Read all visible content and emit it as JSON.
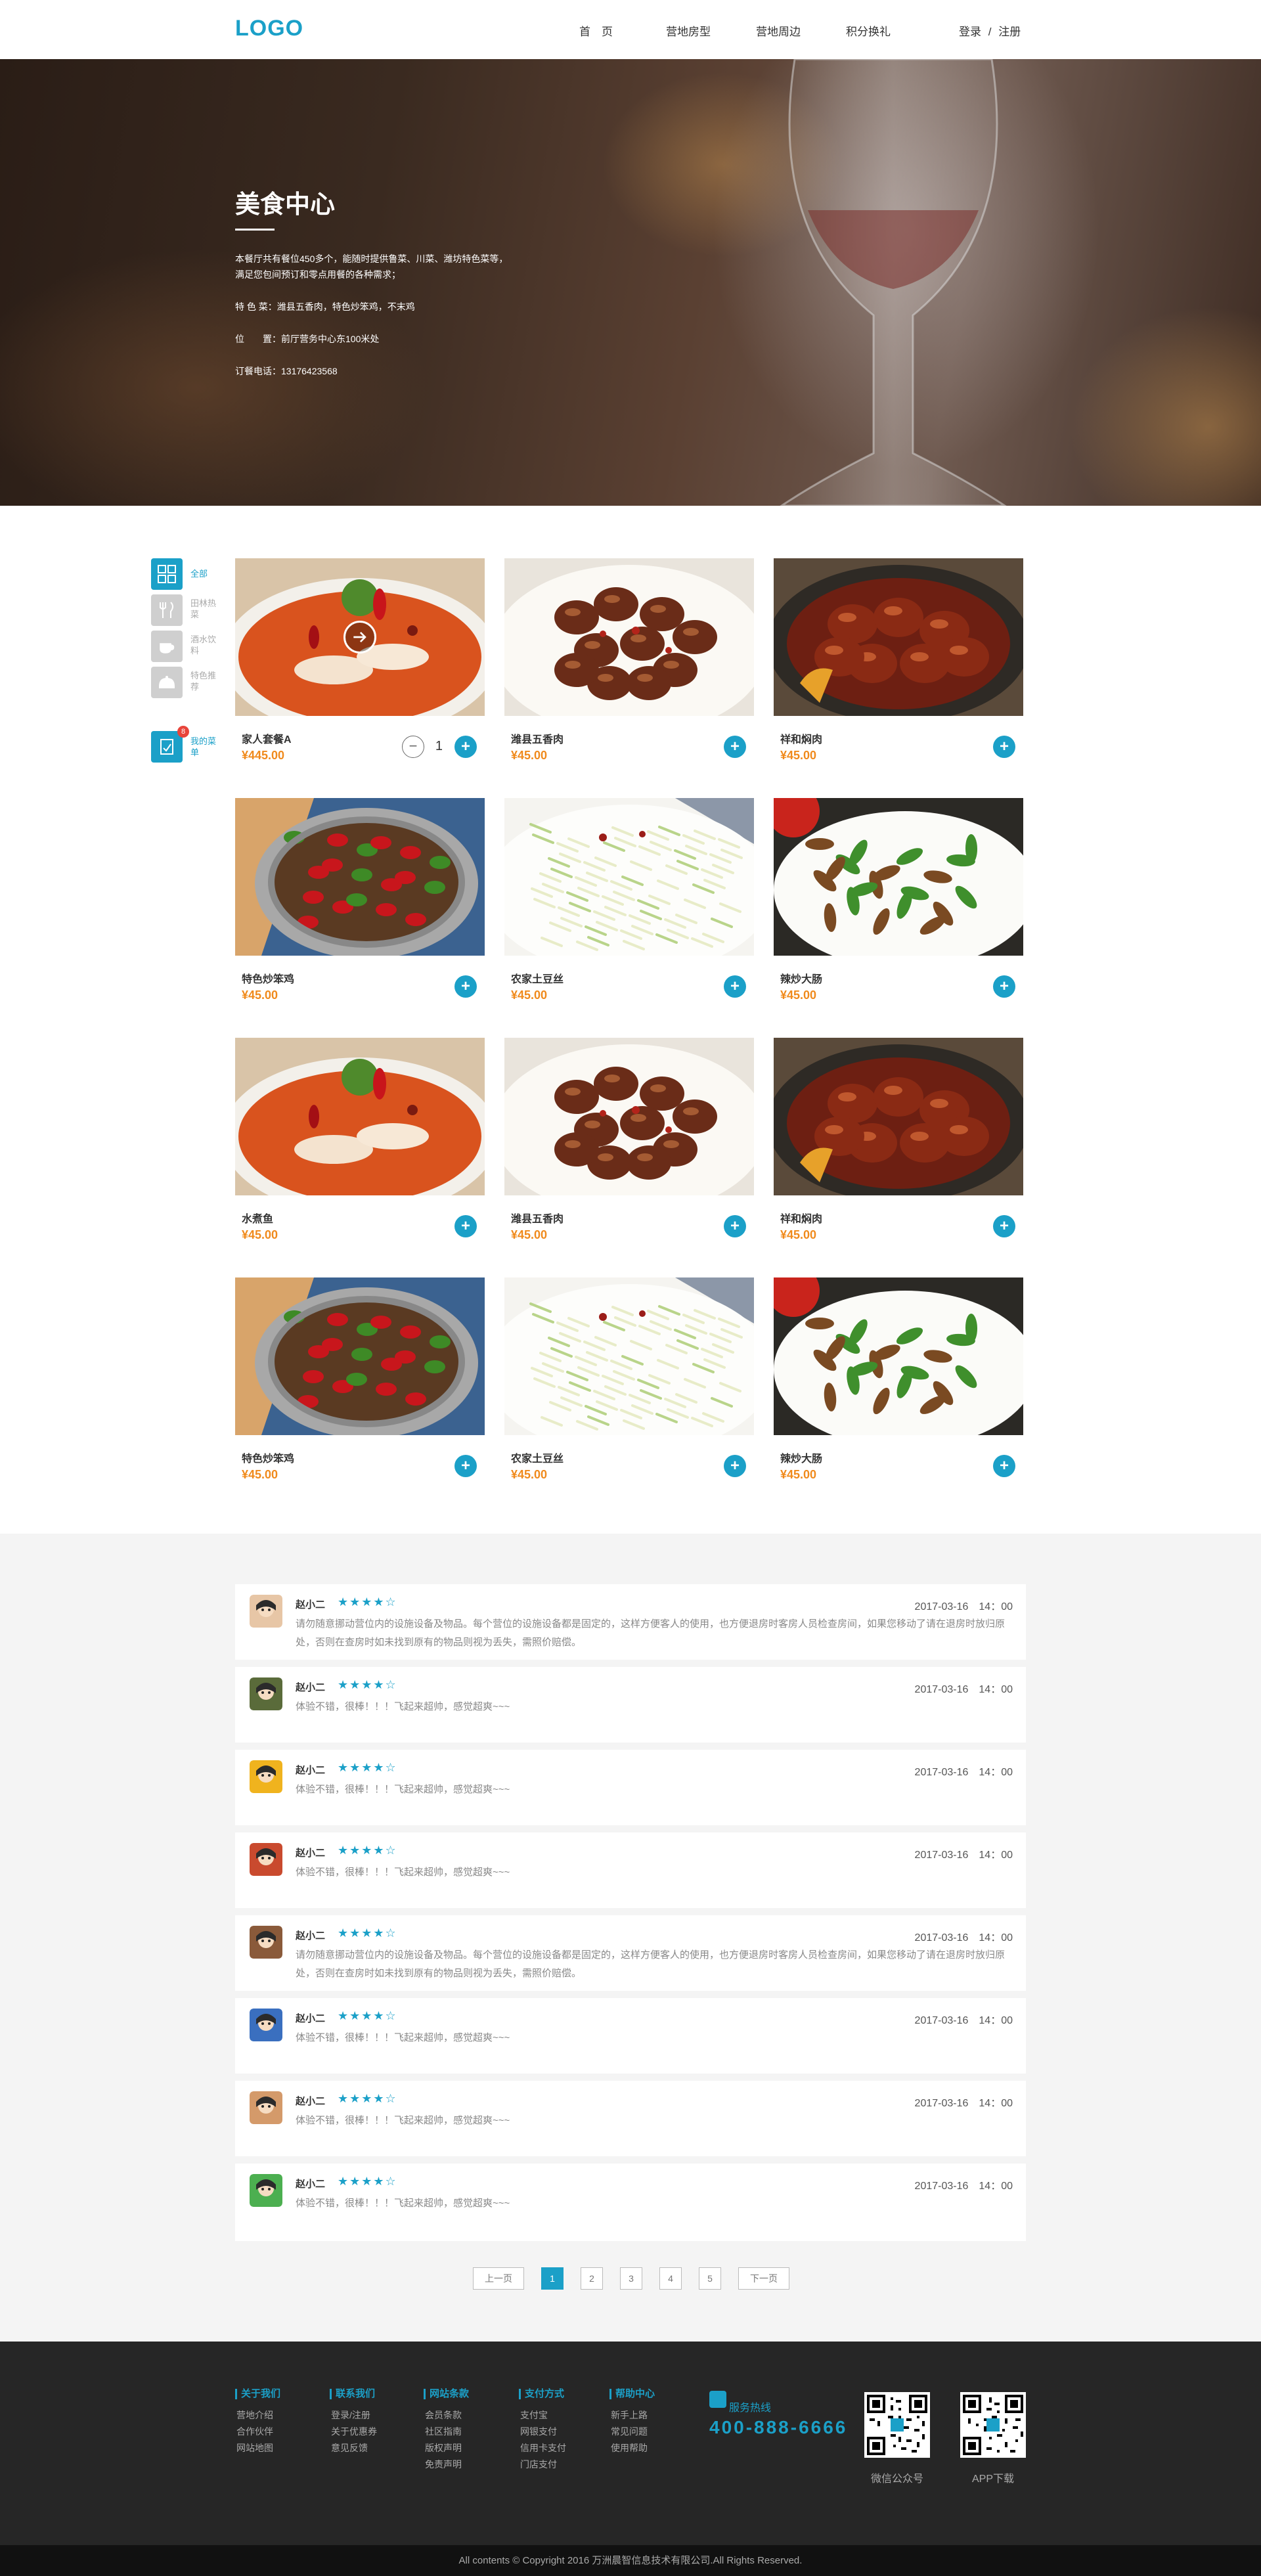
{
  "header": {
    "logo": "LOGO",
    "nav": [
      "首　页",
      "营地房型",
      "营地周边",
      "积分换礼"
    ],
    "login": "登录",
    "separator": "/",
    "register": "注册"
  },
  "hero": {
    "title": "美食中心",
    "intro_line1": "本餐厅共有餐位450多个，能随时提供鲁菜、川菜、潍坊特色菜等，",
    "intro_line2": "满足您包间预订和零点用餐的各种需求；",
    "specialty": "特 色 菜：潍县五香肉，特色炒笨鸡，不末鸡",
    "location": "位　　置：前厅营务中心东100米处",
    "phone": "订餐电话：13176423568"
  },
  "sidebar": {
    "items": [
      {
        "label": "全部",
        "icon": "grid-icon"
      },
      {
        "label": "田林热菜",
        "icon": "fork-knife-icon"
      },
      {
        "label": "酒水饮料",
        "icon": "coffee-cup-icon"
      },
      {
        "label": "特色推荐",
        "icon": "cloche-icon"
      }
    ],
    "menu_label": "我的菜单",
    "menu_badge": "8"
  },
  "dishes": [
    {
      "name": "家人套餐A",
      "price": "¥445.00",
      "quantity": "1",
      "image": "fish-hotpot"
    },
    {
      "name": "潍县五香肉",
      "price": "¥45.00",
      "image": "braised-pork"
    },
    {
      "name": "祥和焖肉",
      "price": "¥45.00",
      "image": "pot-stew"
    },
    {
      "name": "特色炒笨鸡",
      "price": "¥45.00",
      "image": "chicken-pot"
    },
    {
      "name": "农家土豆丝",
      "price": "¥45.00",
      "image": "potato-shreds"
    },
    {
      "name": "辣炒大肠",
      "price": "¥45.00",
      "image": "pepper-intestine"
    },
    {
      "name": "水煮鱼",
      "price": "¥45.00",
      "image": "fish-hotpot"
    },
    {
      "name": "潍县五香肉",
      "price": "¥45.00",
      "image": "braised-pork"
    },
    {
      "name": "祥和焖肉",
      "price": "¥45.00",
      "image": "pot-stew"
    },
    {
      "name": "特色炒笨鸡",
      "price": "¥45.00",
      "image": "chicken-pot"
    },
    {
      "name": "农家土豆丝",
      "price": "¥45.00",
      "image": "potato-shreds"
    },
    {
      "name": "辣炒大肠",
      "price": "¥45.00",
      "image": "pepper-intestine"
    }
  ],
  "comments": [
    {
      "name": "赵小二",
      "stars": "★★★★☆",
      "rating": 4,
      "date": "2017-03-16　14：00",
      "text": "请勿随意挪动营位内的设施设备及物品。每个营位的设施设备都是固定的，这样方便客人的使用，也方便退房时客房人员检查房间，如果您移动了请在退房时放归原处，否则在查房时如未找到原有的物品则视为丢失，需照价赔偿。"
    },
    {
      "name": "赵小二",
      "stars": "★★★★☆",
      "rating": 4,
      "date": "2017-03-16　14：00",
      "text": "体验不错，很棒！！！飞起来超帅，感觉超爽~~~"
    },
    {
      "name": "赵小二",
      "stars": "★★★★☆",
      "rating": 4,
      "date": "2017-03-16　14：00",
      "text": "体验不错，很棒！！！飞起来超帅，感觉超爽~~~"
    },
    {
      "name": "赵小二",
      "stars": "★★★★☆",
      "rating": 4,
      "date": "2017-03-16　14：00",
      "text": "体验不错，很棒！！！飞起来超帅，感觉超爽~~~"
    },
    {
      "name": "赵小二",
      "stars": "★★★★☆",
      "rating": 4,
      "date": "2017-03-16　14：00",
      "text": "请勿随意挪动营位内的设施设备及物品。每个营位的设施设备都是固定的，这样方便客人的使用，也方便退房时客房人员检查房间，如果您移动了请在退房时放归原处，否则在查房时如未找到原有的物品则视为丢失，需照价赔偿。"
    },
    {
      "name": "赵小二",
      "stars": "★★★★☆",
      "rating": 4,
      "date": "2017-03-16　14：00",
      "text": "体验不错，很棒！！！飞起来超帅，感觉超爽~~~"
    },
    {
      "name": "赵小二",
      "stars": "★★★★☆",
      "rating": 4,
      "date": "2017-03-16　14：00",
      "text": "体验不错，很棒！！！飞起来超帅，感觉超爽~~~"
    },
    {
      "name": "赵小二",
      "stars": "★★★★☆",
      "rating": 4,
      "date": "2017-03-16　14：00",
      "text": "体验不错，很棒！！！飞起来超帅，感觉超爽~~~"
    }
  ],
  "pagination": {
    "prev": "上一页",
    "pages": [
      "1",
      "2",
      "3",
      "4",
      "5"
    ],
    "current": "1",
    "next": "下一页"
  },
  "footer": {
    "columns": [
      {
        "title": "关于我们",
        "links": [
          "营地介绍",
          "合作伙伴",
          "网站地图"
        ]
      },
      {
        "title": "联系我们",
        "links": [
          "登录/注册",
          "关于优惠券",
          "意见反馈"
        ]
      },
      {
        "title": "网站条款",
        "links": [
          "会员条款",
          "社区指南",
          "版权声明",
          "免责声明"
        ]
      },
      {
        "title": "支付方式",
        "links": [
          "支付宝",
          "网银支付",
          "信用卡支付",
          "门店支付"
        ]
      },
      {
        "title": "帮助中心",
        "links": [
          "新手上路",
          "常见问题",
          "使用帮助"
        ]
      }
    ],
    "hotline_label": "服务热线",
    "hotline": "400-888-6666",
    "qr_wechat_label": "微信公众号",
    "qr_app_label": "APP下载",
    "copyright": "All contents © Copyright 2016 万洲晨智信息技术有限公司.All Rights Reserved."
  },
  "colors": {
    "accent": "#1ba0c8",
    "price": "#f08a1c",
    "footer_bg": "#262626"
  }
}
